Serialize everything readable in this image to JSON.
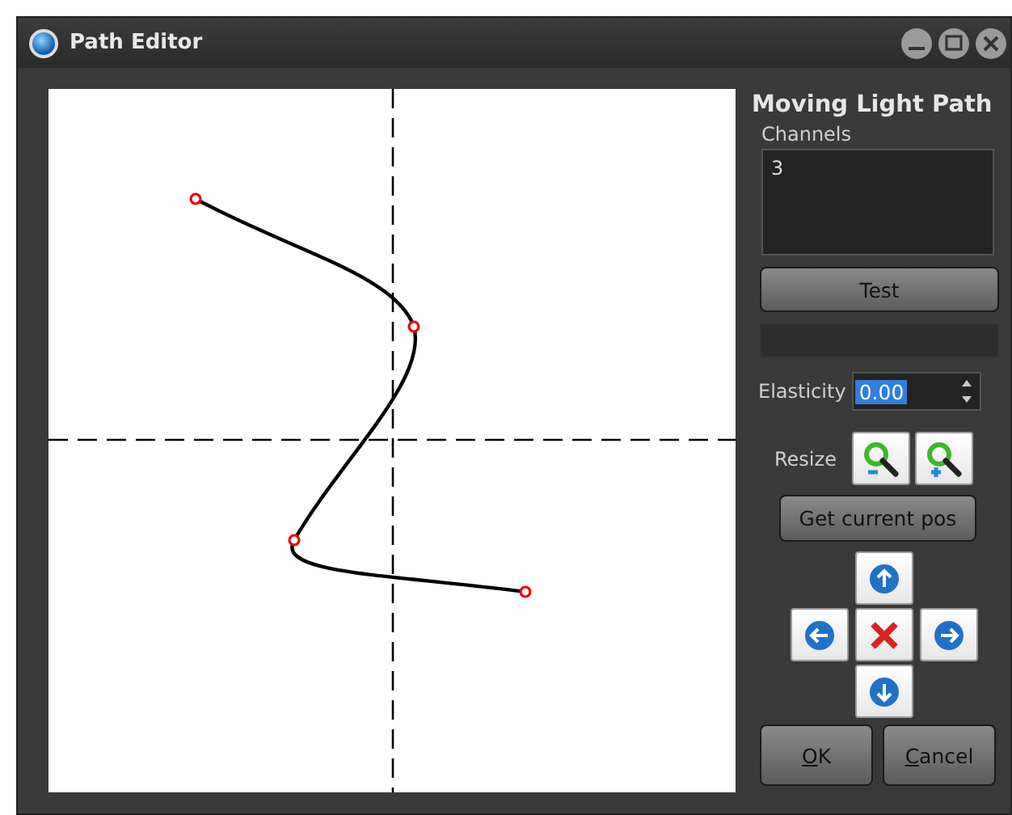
{
  "window": {
    "title": "Path Editor"
  },
  "panel": {
    "title": "Moving Light Path",
    "channels_label": "Channels",
    "channels_value": "3",
    "test_button": "Test",
    "elasticity": {
      "label": "Elasticity",
      "value": "0.00",
      "value_selected": true
    },
    "resize_label": "Resize",
    "get_pos_button": "Get current pos"
  },
  "buttons": [
    {
      "label": "OK"
    },
    {
      "label": "Cancel"
    }
  ]
}
